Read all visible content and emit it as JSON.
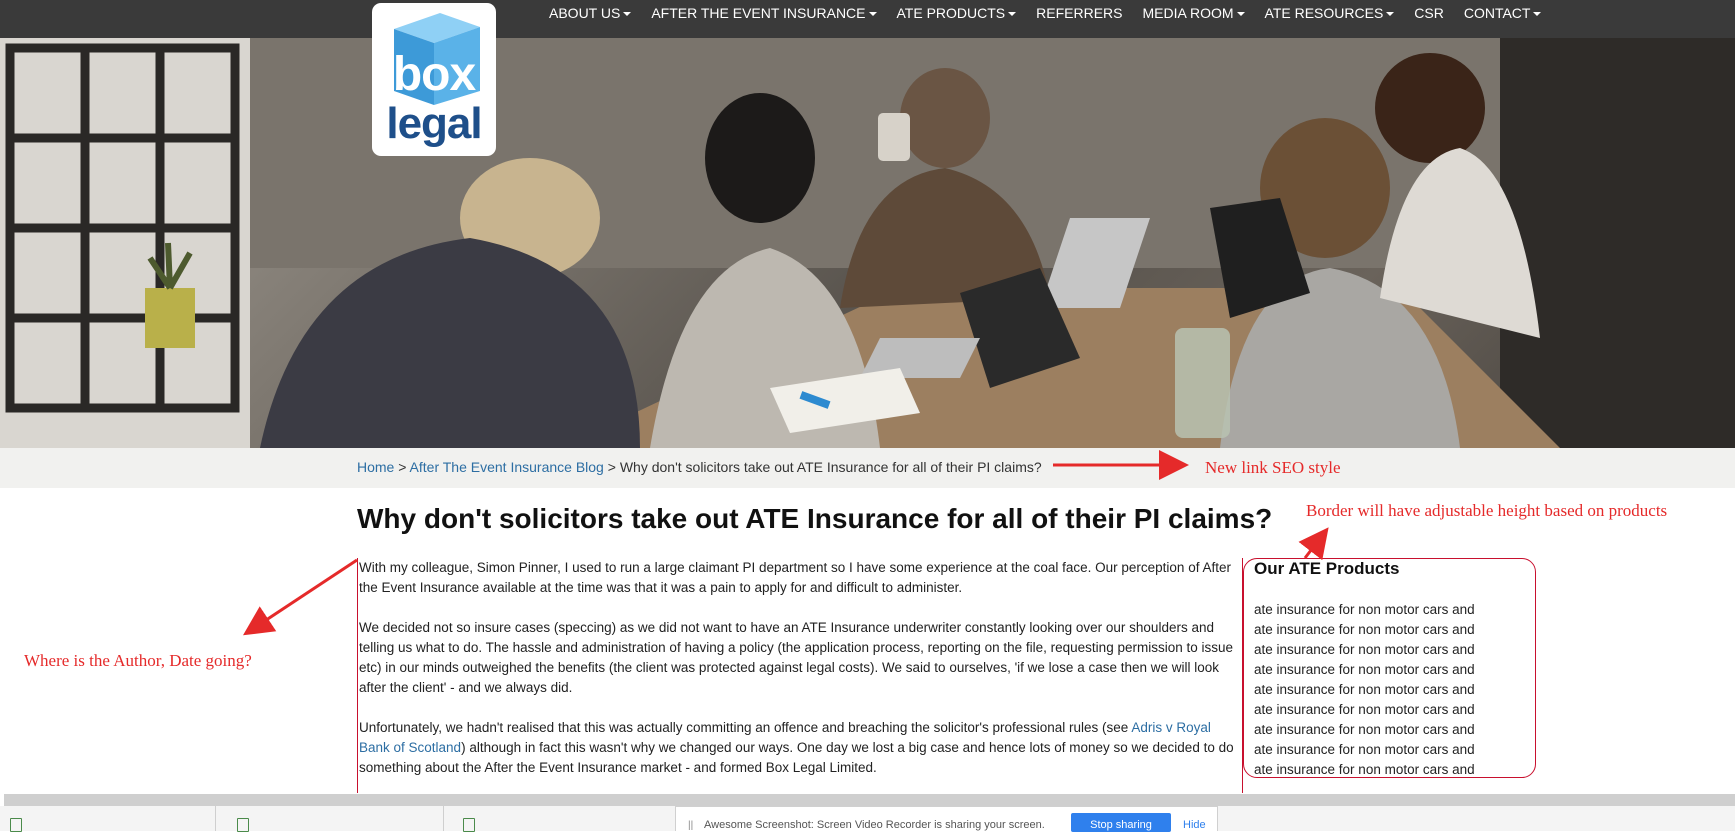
{
  "nav": {
    "items": [
      {
        "label": "ABOUT US",
        "dropdown": true
      },
      {
        "label": "AFTER THE EVENT INSURANCE",
        "dropdown": true
      },
      {
        "label": "ATE PRODUCTS",
        "dropdown": true
      },
      {
        "label": "REFERRERS",
        "dropdown": false
      },
      {
        "label": "MEDIA ROOM",
        "dropdown": true
      },
      {
        "label": "ATE RESOURCES",
        "dropdown": true
      },
      {
        "label": "CSR",
        "dropdown": false
      },
      {
        "label": "CONTACT",
        "dropdown": true
      }
    ]
  },
  "logo": {
    "word1": "box",
    "word2": "legal"
  },
  "breadcrumb": {
    "home": "Home",
    "separator": " > ",
    "blog": "After The Event Insurance Blog",
    "current": "Why don't solicitors take out ATE Insurance for all of their PI claims?"
  },
  "annotations": {
    "seo": "New link SEO style",
    "border": "Border will have adjustable height based on products",
    "author": "Where is the Author, Date going?"
  },
  "article": {
    "title": "Why don't solicitors take out ATE Insurance for all of their PI claims?",
    "p1": "With my colleague, Simon Pinner, I used to run a large claimant PI department so I have some experience at the coal face. Our perception of After the Event Insurance available at the time was that it was a pain to apply for and difficult to administer.",
    "p2": "We decided not so insure cases (speccing) as we did not want to have an ATE Insurance underwriter constantly looking over our shoulders and telling us what to do. The hassle and administration of having a policy (the application process, reporting on the file, requesting permission to issue etc) in our minds outweighed the benefits (the client was protected against legal costs). We said to ourselves, 'if we lose a case then we will look after the client' - and we always did.",
    "p3_before": "Unfortunately, we hadn't realised that this was actually committing an offence and breaching the solicitor's professional rules (see ",
    "p3_link": "Adris v Royal Bank of Scotland",
    "p3_after": ") although in fact this wasn't why we changed our ways. One day we lost a big case and hence lots of money so we decided to do something about the After the Event Insurance market - and formed Box Legal Limited."
  },
  "products": {
    "title": "Our ATE Products",
    "items": [
      "ate insurance for non motor cars and",
      "ate insurance for non motor cars and",
      "ate insurance for non motor cars and",
      "ate insurance for non motor cars and",
      "ate insurance for non motor cars and",
      "ate insurance for non motor cars and",
      "ate insurance for non motor cars and",
      "ate insurance for non motor cars and",
      "ate insurance for non motor cars and"
    ]
  },
  "share_bar": {
    "text": "Awesome Screenshot: Screen Video Recorder is sharing your screen.",
    "stop_label": "Stop sharing",
    "hide_label": "Hide"
  },
  "colors": {
    "nav_bg": "#3a3a3a",
    "link": "#2d6ea3",
    "annotation": "#e52a2a",
    "border_red": "#c8102e",
    "logo_blue": "#1e4f8a",
    "logo_cube": "#5ab2e8"
  }
}
